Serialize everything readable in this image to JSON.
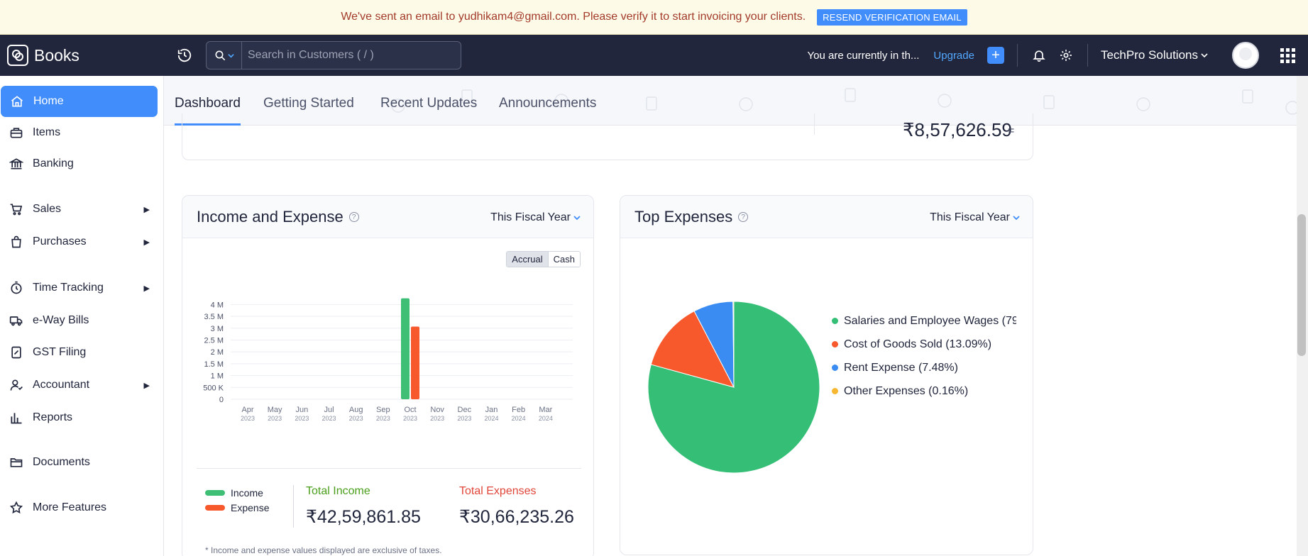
{
  "banner": {
    "message": "We've sent an email to yudhikam4@gmail.com. Please verify it to start invoicing your clients.",
    "button": "RESEND VERIFICATION EMAIL"
  },
  "topbar": {
    "brand": "Books",
    "search_placeholder": "Search in Customers ( / )",
    "trial_text": "You are currently in th...",
    "upgrade": "Upgrade",
    "org_name": "TechPro Solutions"
  },
  "sidebar": {
    "items": [
      {
        "label": "Home",
        "icon": "home-icon"
      },
      {
        "label": "Items",
        "icon": "items-icon"
      },
      {
        "label": "Banking",
        "icon": "bank-icon"
      },
      {
        "label": "Sales",
        "icon": "cart-icon"
      },
      {
        "label": "Purchases",
        "icon": "bag-icon"
      },
      {
        "label": "Time Tracking",
        "icon": "timer-icon"
      },
      {
        "label": "e-Way Bills",
        "icon": "truck-icon"
      },
      {
        "label": "GST Filing",
        "icon": "gst-icon"
      },
      {
        "label": "Accountant",
        "icon": "accountant-icon"
      },
      {
        "label": "Reports",
        "icon": "reports-icon"
      },
      {
        "label": "Documents",
        "icon": "folder-icon"
      },
      {
        "label": "More Features",
        "icon": "star-icon"
      }
    ]
  },
  "tabs": [
    "Dashboard",
    "Getting Started",
    "Recent Updates",
    "Announcements"
  ],
  "top_card": {
    "amount": "₹8,57,626.59",
    "trailing": "="
  },
  "income_expense": {
    "title": "Income and Expense",
    "period": "This Fiscal Year",
    "toggle": [
      "Accrual",
      "Cash"
    ],
    "legend": [
      "Income",
      "Expense"
    ],
    "total_income_label": "Total Income",
    "total_income": "₹42,59,861.85",
    "total_expenses_label": "Total Expenses",
    "total_expenses": "₹30,66,235.26",
    "footnote": "* Income and expense values displayed are exclusive of taxes.",
    "colors": {
      "income": "#3fbf76",
      "expense": "#f7582c"
    }
  },
  "chart_data": [
    {
      "type": "bar",
      "categories": [
        "Apr 2023",
        "May 2023",
        "Jun 2023",
        "Jul 2023",
        "Aug 2023",
        "Sep 2023",
        "Oct 2023",
        "Nov 2023",
        "Dec 2023",
        "Jan 2024",
        "Feb 2024",
        "Mar 2024"
      ],
      "month_labels": [
        "Apr",
        "May",
        "Jun",
        "Jul",
        "Aug",
        "Sep",
        "Oct",
        "Nov",
        "Dec",
        "Jan",
        "Feb",
        "Mar"
      ],
      "year_labels": [
        "2023",
        "2023",
        "2023",
        "2023",
        "2023",
        "2023",
        "2023",
        "2023",
        "2023",
        "2024",
        "2024",
        "2024"
      ],
      "series": [
        {
          "name": "Income",
          "values": [
            0,
            0,
            0,
            0,
            0,
            0,
            4259861.85,
            0,
            0,
            0,
            0,
            0
          ]
        },
        {
          "name": "Expense",
          "values": [
            0,
            0,
            0,
            0,
            0,
            0,
            3066235.26,
            0,
            0,
            0,
            0,
            0
          ]
        }
      ],
      "yticks": [
        "0",
        "500 K",
        "1 M",
        "1.5 M",
        "2 M",
        "2.5 M",
        "3 M",
        "3.5 M",
        "4 M"
      ],
      "ylim": [
        0,
        4250000
      ]
    },
    {
      "type": "pie",
      "title": "Top Expenses",
      "period": "This Fiscal Year",
      "labels": [
        "Salaries and Employee Wages (79",
        "Cost of Goods Sold (13.09%)",
        "Rent Expense (7.48%)",
        "Other Expenses (0.16%)"
      ],
      "values": [
        79.27,
        13.09,
        7.48,
        0.16
      ],
      "colors": [
        "#35bf76",
        "#f7582c",
        "#3a8cf2",
        "#f7b731"
      ]
    }
  ]
}
